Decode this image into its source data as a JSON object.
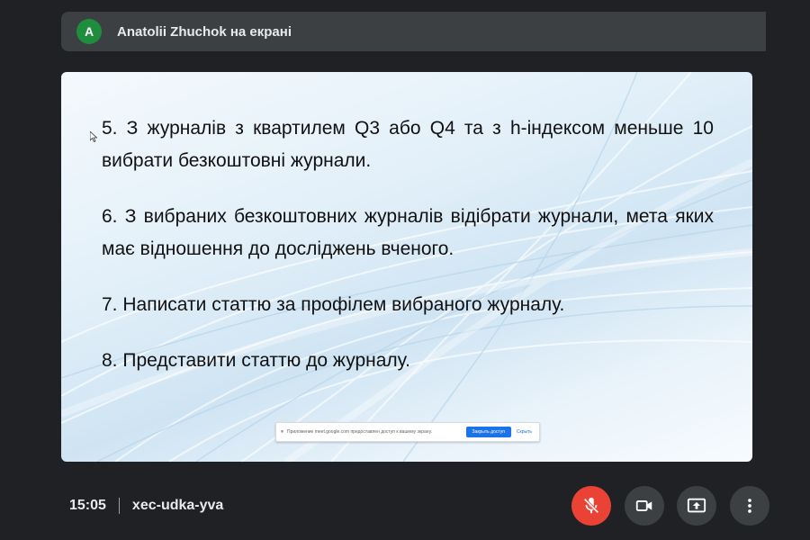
{
  "presenter": {
    "avatar_letter": "A",
    "label": "Anatolii Zhuchok на екрані"
  },
  "slide": {
    "items": [
      "5. З журналів з квартилем Q3 або Q4 та з h-індексом меньше 10 вибрати безкоштовні журнали.",
      "6. З  вибраних безкоштовних журналів відібрати журнали, мета яких має відношення до досліджень вченого.",
      "7. Написати статтю за профілем вибраного журналу.",
      "8. Представити статтю до журналу."
    ]
  },
  "share_banner": {
    "text": "Приложение meet.google.com предоставлен доступ к вашему экрану.",
    "stop_label": "Закрыть доступ",
    "hide_label": "Скрыть"
  },
  "meeting": {
    "time": "15:05",
    "code": "xec-udka-yva"
  },
  "controls": {
    "mic_icon": "mic-off-icon",
    "camera_icon": "videocam-icon",
    "present_icon": "present-screen-icon",
    "more_icon": "more-vert-icon"
  },
  "colors": {
    "background": "#202124",
    "bar": "#3c4043",
    "avatar": "#1e8e3e",
    "mic_off": "#ea4335",
    "accent": "#1a73e8"
  }
}
